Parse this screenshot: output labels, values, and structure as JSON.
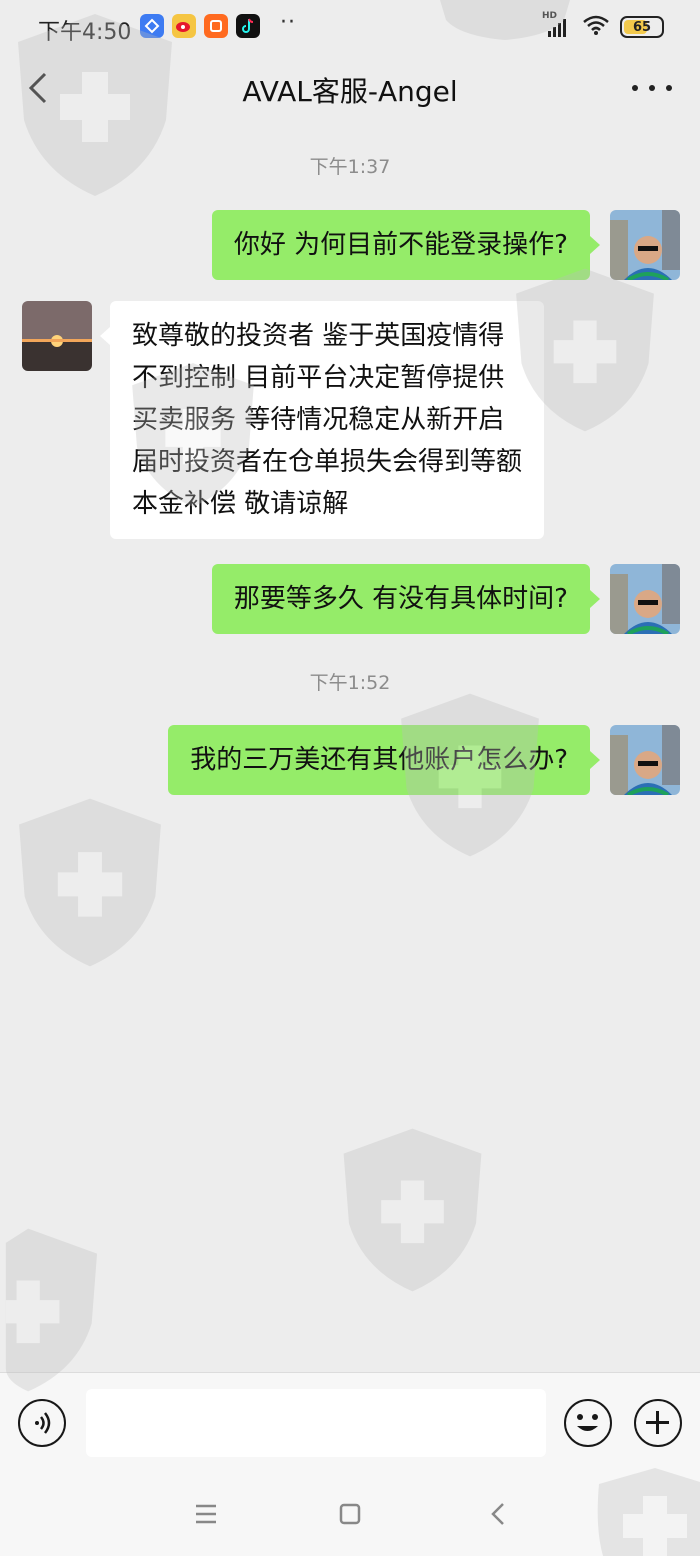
{
  "status_bar": {
    "time": "下午4:50",
    "network": "HD",
    "battery": "65",
    "battery_level": 0.65,
    "app_icons": [
      "blue-app-icon",
      "weibo-icon",
      "orange-app-icon",
      "tiktok-icon"
    ],
    "more": "··"
  },
  "nav": {
    "title": "AVAL客服-Angel"
  },
  "messages": [
    {
      "type": "timestamp",
      "text": "下午1:37"
    },
    {
      "type": "sent",
      "lines": [
        "你好 为何目前不能登录操作?"
      ]
    },
    {
      "type": "received",
      "lines": [
        "致尊敬的投资者 鉴于英国疫情得",
        "不到控制 目前平台决定暂停提供",
        "买卖服务 等待情况稳定从新开启",
        "届时投资者在仓单损失会得到等额",
        "本金补偿 敬请谅解"
      ]
    },
    {
      "type": "sent",
      "lines": [
        "那要等多久 有没有具体时间?"
      ]
    },
    {
      "type": "timestamp",
      "text": "下午1:52"
    },
    {
      "type": "sent",
      "lines": [
        "我的三万美还有其他账户怎么办?"
      ]
    }
  ],
  "colors": {
    "background": "#ededed",
    "sent_bubble": "#95ec69",
    "received_bubble": "#ffffff",
    "timestamp": "#8c8c8c"
  },
  "input_bar": {
    "voice_icon": "voice-icon",
    "emoji_icon": "emoji-icon",
    "plus_icon": "plus-icon"
  },
  "system_nav": {
    "menu_icon": "menu-icon",
    "home_icon": "home-icon",
    "back_icon": "back-icon"
  }
}
